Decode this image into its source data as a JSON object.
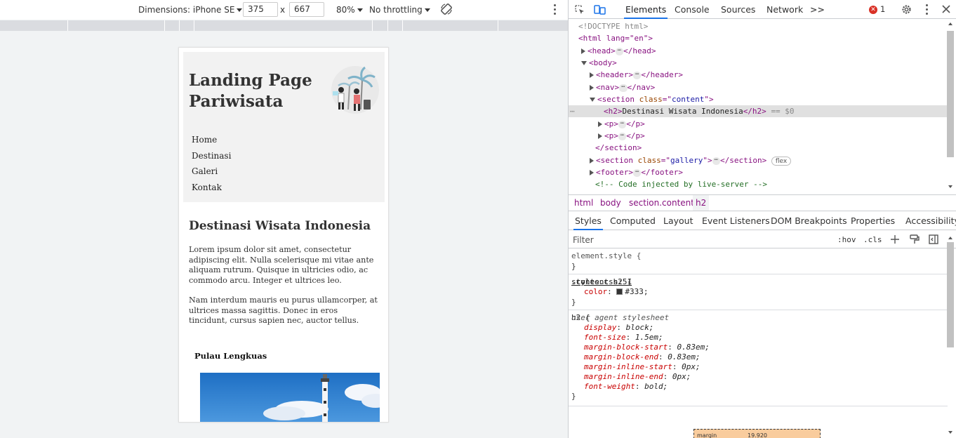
{
  "device_toolbar": {
    "dimensions_label": "Dimensions: iPhone SE",
    "width": "375",
    "height": "667",
    "times": "x",
    "zoom": "80%",
    "throttling": "No throttling"
  },
  "page": {
    "title": "Landing Page Pariwisata",
    "nav": [
      "Home",
      "Destinasi",
      "Galeri",
      "Kontak"
    ],
    "heading": "Destinasi Wisata Indonesia",
    "para1": "Lorem ipsum dolor sit amet, consectetur adipiscing elit. Nulla scelerisque mi vitae ante aliquam rutrum. Quisque in ultricies odio, ac commodo arcu. Integer et ultrices leo.",
    "para2": "Nam interdum mauris eu purus ullamcorper, at ultrices massa sagittis. Donec in eros tincidunt, cursus sapien nec, auctor tellus.",
    "gallery_title": "Pulau Lengkuas"
  },
  "devtools": {
    "tabs": [
      "Elements",
      "Console",
      "Sources",
      "Network"
    ],
    "more_tabs": ">>",
    "error_count": "1",
    "dom": {
      "doctype": "<!DOCTYPE html>",
      "html_open": "<html lang=\"en\">",
      "head": "head",
      "body": "body",
      "header": "header",
      "nav": "nav",
      "section_tag": "section",
      "section_class_attr": "class",
      "section_class": "content",
      "h2_text": "Destinasi Wisata Indonesia",
      "eq_marker": "== $0",
      "p": "p",
      "section_close": "</section>",
      "gallery_class": "gallery",
      "flex_badge": "flex",
      "footer": "footer",
      "comment": "<!-- Code injected by live-server -->",
      "dots": "..."
    },
    "breadcrumbs": [
      "html",
      "body",
      "section.content",
      "h2"
    ],
    "style_tabs": [
      "Styles",
      "Computed",
      "Layout",
      "Event Listeners",
      "DOM Breakpoints",
      "Properties",
      "Accessibility"
    ],
    "filter_placeholder": "Filter",
    "hov": ":hov",
    "cls": ".cls",
    "rules": {
      "element_style": "element.style {",
      "close": "}",
      "content_h2_selector": ".content h2 {",
      "content_h2_source": "styles.css:51",
      "color_prop": "color",
      "color_value": "#333;",
      "h2_selector": "h2 {",
      "ua_label": "user agent stylesheet",
      "ua_props": [
        {
          "name": "display",
          "value": "block;"
        },
        {
          "name": "font-size",
          "value": "1.5em;"
        },
        {
          "name": "margin-block-start",
          "value": "0.83em;"
        },
        {
          "name": "margin-block-end",
          "value": "0.83em;"
        },
        {
          "name": "margin-inline-start",
          "value": "0px;"
        },
        {
          "name": "margin-inline-end",
          "value": "0px;"
        },
        {
          "name": "font-weight",
          "value": "bold;"
        }
      ]
    },
    "box_model": {
      "label": "margin",
      "value": "19.920"
    }
  },
  "colors": {
    "accent": "#1a73e8",
    "tag": "#881280",
    "attr": "#994500",
    "value": "#1a1aa6",
    "error": "#d93025",
    "swatch": "#333333"
  }
}
